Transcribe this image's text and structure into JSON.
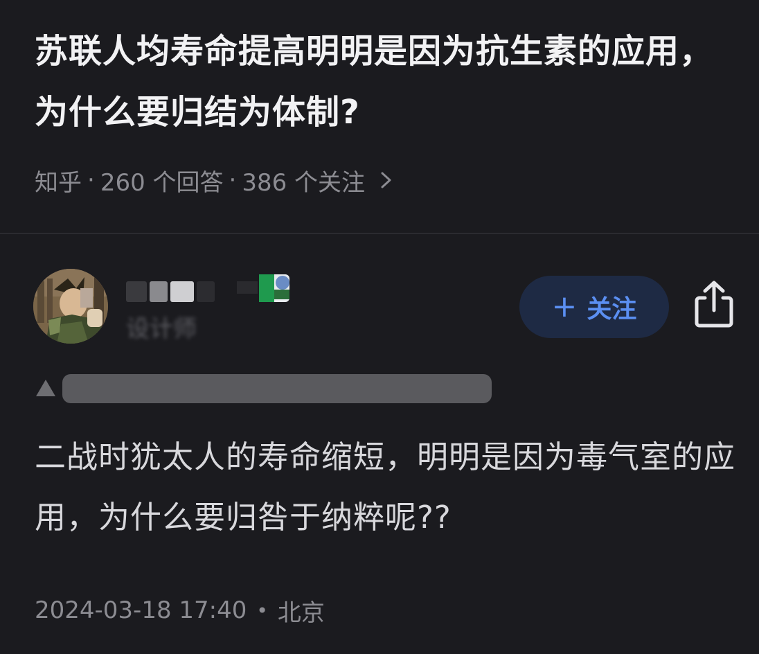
{
  "question": {
    "title": "苏联人均寿命提高明明是因为抗生素的应用，为什么要归结为体制?",
    "source": "知乎",
    "answers": "260 个回答",
    "followers": "386 个关注"
  },
  "author": {
    "name": "",
    "description": "设计师",
    "follow_label": "关注"
  },
  "answer": {
    "content": "二战时犹太人的寿命缩短，明明是因为毒气室的应用，为什么要归咎于纳粹呢??",
    "date": "2024-03-18 17:40",
    "location": "北京"
  },
  "colors": {
    "background": "#1b1b1f",
    "accent": "#5b8ff2",
    "follow_bg": "#1e2a44",
    "muted": "#8c8c92"
  },
  "icons": {
    "meta_link": "chevron-right-icon",
    "share": "share-icon",
    "follow": "plus-icon",
    "vote": "upvote-triangle-icon"
  }
}
